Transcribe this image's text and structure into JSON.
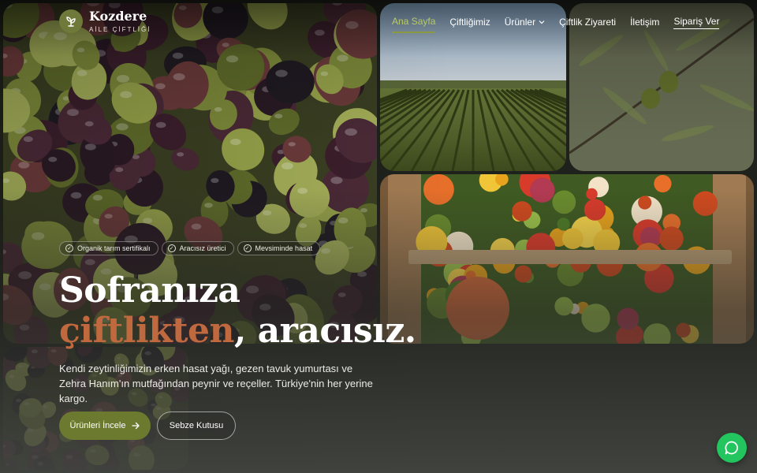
{
  "brand": {
    "name": "Kozdere",
    "tagline": "AİLE ÇİFTLİĞİ",
    "icon": "sprout-icon"
  },
  "nav": {
    "items": [
      {
        "label": "Ana Sayfa",
        "active": true
      },
      {
        "label": "Çiftliğimiz"
      },
      {
        "label": "Ürünler",
        "has_dropdown": true
      },
      {
        "label": "Çiftlik Ziyareti"
      },
      {
        "label": "İletişim"
      }
    ],
    "cta": "Sipariş Ver"
  },
  "badges": [
    {
      "label": "Organik tarım sertifikalı",
      "icon": "check-circle-icon"
    },
    {
      "label": "Aracısız üretici",
      "icon": "check-circle-icon"
    },
    {
      "label": "Mevsiminde hasat",
      "icon": "check-circle-icon"
    }
  ],
  "hero": {
    "headline_line1": "Sofranıza",
    "headline_accent": "çiftlikten",
    "headline_rest": ", aracısız.",
    "lede": "Kendi zeytinliğimizin erken hasat yağı, gezen tavuk yumurtası ve Zehra Hanım'ın mutfağından peynir ve reçeller. Türkiye'nin her yerine kargo."
  },
  "buttons": {
    "primary": "Ürünleri İncele",
    "primary_icon": "arrow-right-icon",
    "secondary": "Sebze Kutusu"
  },
  "chat": {
    "icon": "chat-bubble-icon"
  },
  "colors": {
    "accent_green": "#6b7a2e",
    "nav_active": "#b9c968",
    "headline_accent": "#c0693e",
    "chat": "#22c55e"
  }
}
